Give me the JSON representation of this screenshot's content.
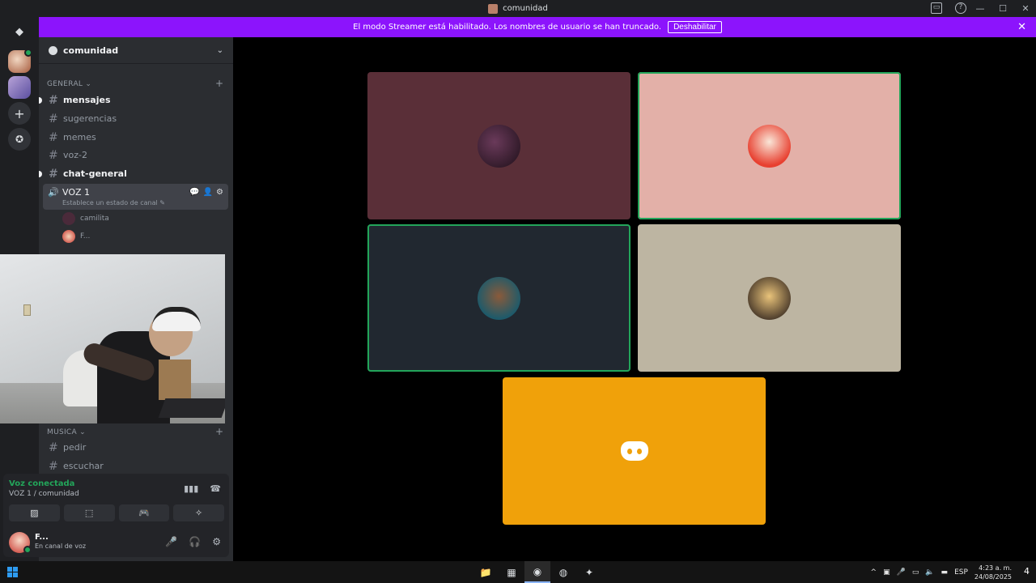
{
  "window": {
    "title": "comunidad",
    "controls": [
      "—",
      "☐",
      "✕"
    ],
    "help": "?",
    "cast": "▭"
  },
  "banner": {
    "text": "El modo Streamer está habilitado. Los nombres de usuario se han truncado.",
    "button": "Deshabilitar",
    "close": "✕"
  },
  "guilds": {
    "home": "◆",
    "add": "+",
    "explore": "✪"
  },
  "server": {
    "name": "comunidad",
    "chevron": "⌄"
  },
  "categories": {
    "general": "GENERAL ⌄",
    "musica": "MUSICA ⌄",
    "add": "+"
  },
  "channels": {
    "mensajes": "mensajes",
    "sugerencias": "sugerencias",
    "memes": "memes",
    "voz2": "voz-2",
    "chat_general": "chat-general",
    "pedir": "pedir",
    "escuchar": "escuchar",
    "hash": "#"
  },
  "voice_channel": {
    "name": "VOZ 1",
    "status": "Establece un estado de canal ✎",
    "icon": "🔊",
    "tools": [
      "💬",
      "👤",
      "⚙"
    ]
  },
  "voice_users": [
    {
      "name": "camilita",
      "color": "#4a2a3a"
    },
    {
      "name": "F...",
      "color": "#c8332c"
    }
  ],
  "voice_panel": {
    "title": "Voz conectada",
    "subtitle": "VOZ 1 / comunidad",
    "icons": [
      "▮▮▮",
      "☎"
    ],
    "buttons": [
      "▨",
      "⬚",
      "🎮",
      "✧"
    ]
  },
  "me": {
    "name": "F...",
    "status": "En canal de voz",
    "tools": [
      "🎤",
      "🎧",
      "⚙"
    ]
  },
  "tiles": [
    {
      "bg": "#5a2f38",
      "avatar": "#3a1f33",
      "speaking": false
    },
    {
      "bg": "#e3b0a8",
      "avatar": "#e84030",
      "speaking": true
    },
    {
      "bg": "#212830",
      "avatar": "#3a5a6a",
      "speaking": true
    },
    {
      "bg": "#bdb5a2",
      "avatar": "#d9b44a",
      "speaking": false
    },
    {
      "bg": "#f0a10a",
      "avatar": "discord-logo",
      "speaking": false
    }
  ],
  "taskbar": {
    "apps": [
      "📁",
      "▦",
      "◉",
      "◍",
      "✦"
    ],
    "tray": [
      "^",
      "▣",
      "🎤",
      "▭",
      "🔈",
      "▬"
    ],
    "lang": "ESP",
    "time": "4:23 a. m.",
    "date": "24/08/2025",
    "notif": "4"
  }
}
